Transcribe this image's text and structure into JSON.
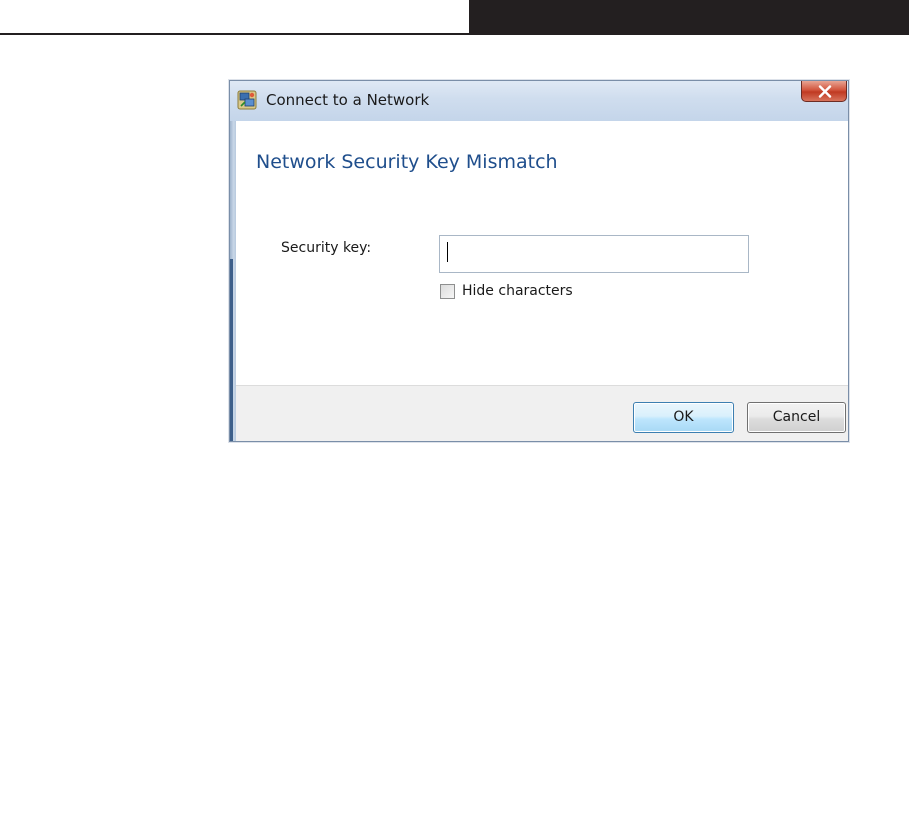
{
  "dialog": {
    "title": "Connect to a Network",
    "heading": "Network Security Key Mismatch",
    "security_key_label": "Security key:",
    "security_key_value": "",
    "hide_characters_label": "Hide characters",
    "hide_characters_checked": false,
    "ok_label": "OK",
    "cancel_label": "Cancel"
  },
  "icons": {
    "title_icon": "network-connection-icon",
    "close_icon": "close-icon"
  },
  "colors": {
    "heading": "#1f4e8c",
    "close_button": "#c03a22",
    "ok_button_border": "#3c7fb1",
    "page_header": "#231f20"
  }
}
